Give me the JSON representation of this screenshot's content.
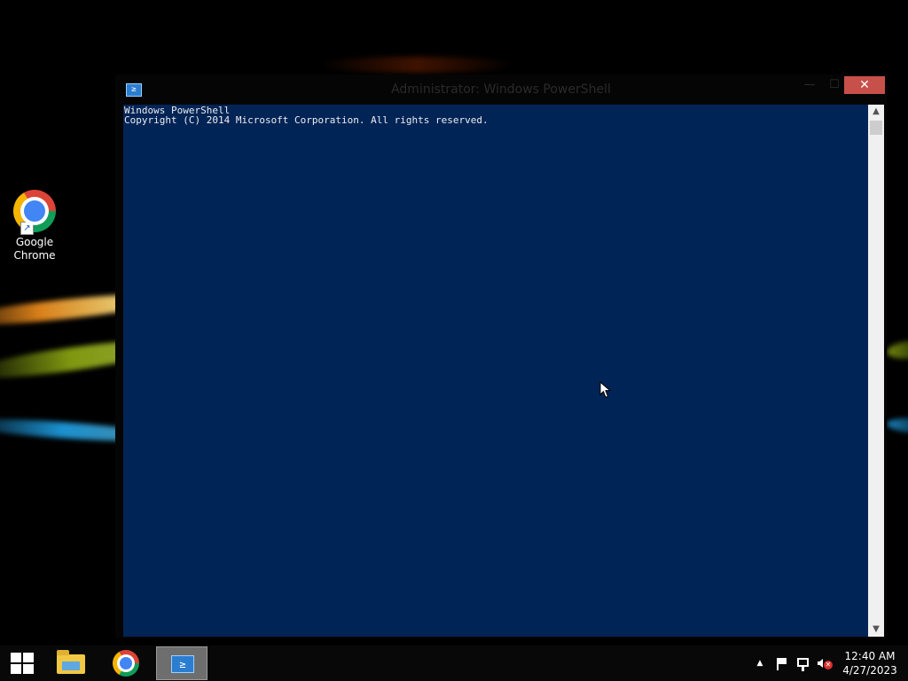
{
  "desktop": {
    "icons": [
      {
        "label": "Google\nChrome",
        "icon": "chrome-icon"
      }
    ]
  },
  "window": {
    "title": "Administrator: Windows PowerShell",
    "icon": "powershell-icon",
    "controls": {
      "minimize": "—",
      "maximize": "☐",
      "close": "✕"
    },
    "console_lines": [
      "Windows PowerShell",
      "Copyright (C) 2014 Microsoft Corporation. All rights reserved."
    ],
    "console_background": "#012456",
    "console_foreground": "#eeedf0"
  },
  "taskbar": {
    "start_icon": "windows-logo-icon",
    "pinned": [
      {
        "name": "File Explorer",
        "icon": "folder-icon"
      },
      {
        "name": "Google Chrome",
        "icon": "chrome-icon"
      },
      {
        "name": "Windows PowerShell",
        "icon": "powershell-icon",
        "active": true
      }
    ],
    "tray": {
      "chevron": "▲",
      "icons": [
        "flag-icon",
        "network-icon",
        "volume-muted-icon"
      ]
    },
    "clock": {
      "time": "12:40 AM",
      "date": "4/27/2023"
    }
  }
}
